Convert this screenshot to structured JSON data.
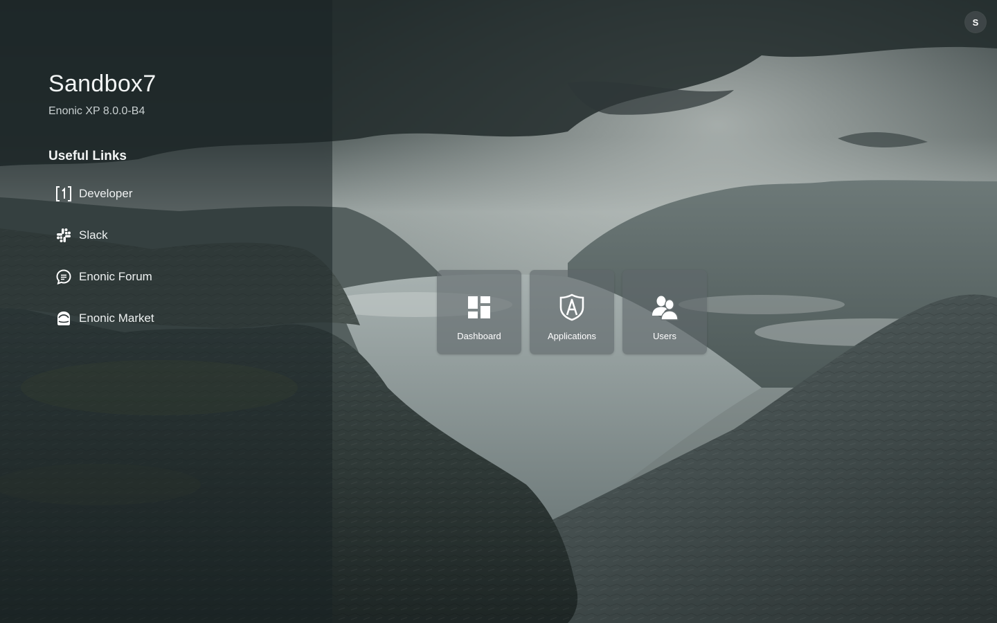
{
  "site": {
    "title": "Sandbox7",
    "version": "Enonic XP 8.0.0-B4"
  },
  "useful_links": {
    "heading": "Useful Links",
    "items": [
      {
        "label": "Developer",
        "icon": "developer-portal-icon"
      },
      {
        "label": "Slack",
        "icon": "slack-icon"
      },
      {
        "label": "Enonic Forum",
        "icon": "forum-icon"
      },
      {
        "label": "Enonic Market",
        "icon": "market-icon"
      }
    ]
  },
  "launcher": {
    "tiles": [
      {
        "label": "Dashboard",
        "icon": "dashboard-icon"
      },
      {
        "label": "Applications",
        "icon": "applications-icon"
      },
      {
        "label": "Users",
        "icon": "users-icon"
      }
    ]
  },
  "user": {
    "avatar_initial": "S"
  },
  "colors": {
    "panel_overlay": "#18222485",
    "tile_background": "#60686a9e",
    "text_primary": "#f2f4f4"
  }
}
